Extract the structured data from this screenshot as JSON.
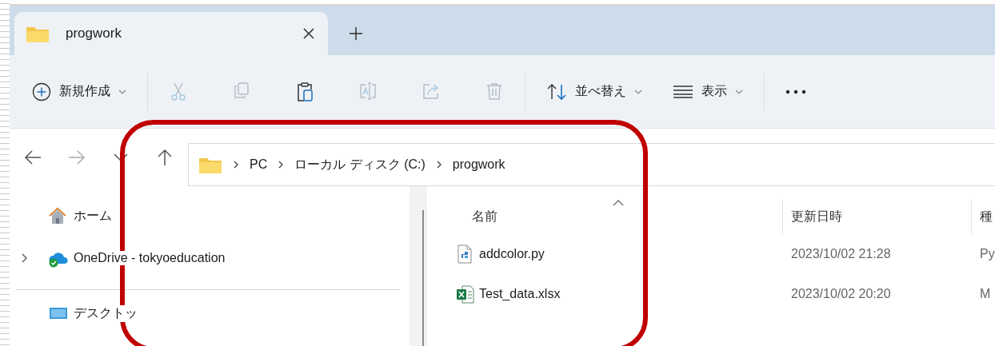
{
  "tab": {
    "title": "progwork",
    "selected": true
  },
  "toolbar": {
    "new": {
      "label": "新規作成"
    },
    "actions": [
      {
        "disabled": true
      },
      {
        "disabled": true
      },
      {
        "disabled": false
      },
      {
        "disabled": true
      },
      {
        "disabled": true
      },
      {
        "disabled": true
      }
    ],
    "sort": {
      "label": "並べ替え"
    },
    "view": {
      "label": "表示"
    }
  },
  "nav_buttons": [
    {
      "disabled": false
    },
    {
      "disabled": true
    },
    {
      "disabled": false
    },
    {
      "disabled": false
    }
  ],
  "address": {
    "segments": [
      "PC",
      "ローカル ディスク (C:)",
      "progwork"
    ]
  },
  "sidebar": {
    "items": [
      {
        "label": "ホーム",
        "kind": "home",
        "expandable": false
      },
      {
        "label": "OneDrive - tokyoeducation",
        "kind": "cloud",
        "expandable": true
      },
      {
        "label": "デスクトッ",
        "kind": "desktop",
        "expandable": false
      }
    ]
  },
  "files": {
    "columns": [
      {
        "label": "名前",
        "sorted": true
      },
      {
        "label": "更新日時",
        "sorted": false
      },
      {
        "label": "種",
        "sorted": false
      }
    ],
    "rows": [
      {
        "name": "addcolor.py",
        "kind": "python",
        "modified": "2023/10/02 21:28",
        "type": "Py"
      },
      {
        "name": "Test_data.xlsx",
        "kind": "excel",
        "modified": "2023/10/02 20:20",
        "type": "M"
      }
    ]
  }
}
